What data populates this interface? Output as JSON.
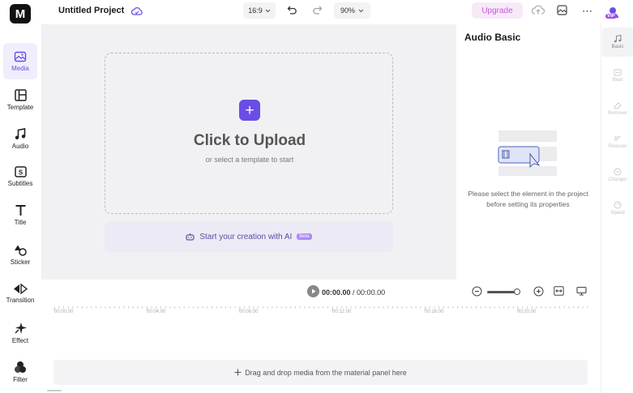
{
  "header": {
    "logo_text": "M",
    "project_title": "Untitled Project",
    "aspect_ratio": "16:9",
    "zoom_level": "90%",
    "upgrade_label": "Upgrade",
    "vip_label": "VIP"
  },
  "sidebar": {
    "items": [
      {
        "label": "Media",
        "icon": "media-icon",
        "active": true
      },
      {
        "label": "Template",
        "icon": "template-icon"
      },
      {
        "label": "Audio",
        "icon": "audio-icon"
      },
      {
        "label": "Subtitles",
        "icon": "subtitles-icon"
      },
      {
        "label": "Title",
        "icon": "title-icon"
      },
      {
        "label": "Sticker",
        "icon": "sticker-icon"
      },
      {
        "label": "Transition",
        "icon": "transition-icon"
      },
      {
        "label": "Effect",
        "icon": "effect-icon"
      },
      {
        "label": "Filter",
        "icon": "filter-icon"
      }
    ]
  },
  "canvas": {
    "upload_title": "Click to Upload",
    "upload_subtitle": "or select a template to start",
    "ai_prompt": "Start your creation with AI",
    "ai_badge": "Beta"
  },
  "panel": {
    "title": "Audio Basic",
    "message": "Please select the element in the project before setting its properties"
  },
  "props": {
    "items": [
      {
        "label": "Basic",
        "active": true
      },
      {
        "label": "Beat"
      },
      {
        "label": "Remover"
      },
      {
        "label": "Reducer"
      },
      {
        "label": "Changer"
      },
      {
        "label": "Speed"
      }
    ]
  },
  "timeline": {
    "current_time": "00:00.00",
    "separator": " / ",
    "total_time": "00:00.00",
    "ruler_labels": [
      "00:00.00",
      "00:04.00",
      "00:08.00",
      "00:12.00",
      "00:16.00",
      "00:20.00"
    ],
    "drop_hint": "Drag and drop media from the material panel here"
  },
  "colors": {
    "accent": "#6b4de6",
    "upgrade_text": "#c35bd8",
    "canvas_bg": "#f1f1f3"
  }
}
